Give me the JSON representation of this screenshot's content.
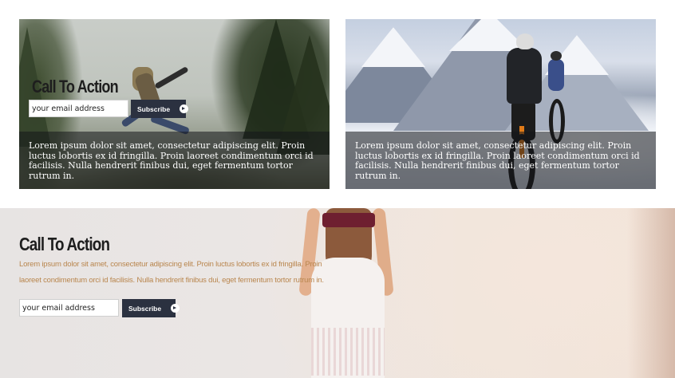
{
  "cards": [
    {
      "title": "Call To Action",
      "email_placeholder": "your email address",
      "button_label": "Subscribe",
      "caption": "Lorem ipsum dolor sit amet, consectetur adipiscing elit. Proin luctus lobortis ex id fringilla. Proin laoreet condimentum orci id facilisis. Nulla hendrerit finibus dui, eget fermentum tortor rutrum in."
    },
    {
      "caption": "Lorem ipsum dolor sit amet, consectetur adipiscing elit. Proin luctus lobortis ex id fringilla. Proin laoreet condimentum orci id facilisis. Nulla hendrerit finibus dui, eget fermentum tortor rutrum in."
    }
  ],
  "hero": {
    "title": "Call To Action",
    "text": "Lorem ipsum dolor sit amet, consectetur adipiscing elit. Proin luctus lobortis ex id fringilla. Proin laoreet condimentum orci id facilisis. Nulla hendrerit finibus dui, eget fermentum tortor rutrum in.",
    "email_placeholder": "your email address",
    "button_label": "Subscribe"
  },
  "icons": {
    "subscribe_arrow": "arrow-right-circle-icon"
  },
  "colors": {
    "button_bg": "#2b3140",
    "hero_text": "#b9864e",
    "caption_overlay": "rgba(20,22,26,0.55)"
  }
}
